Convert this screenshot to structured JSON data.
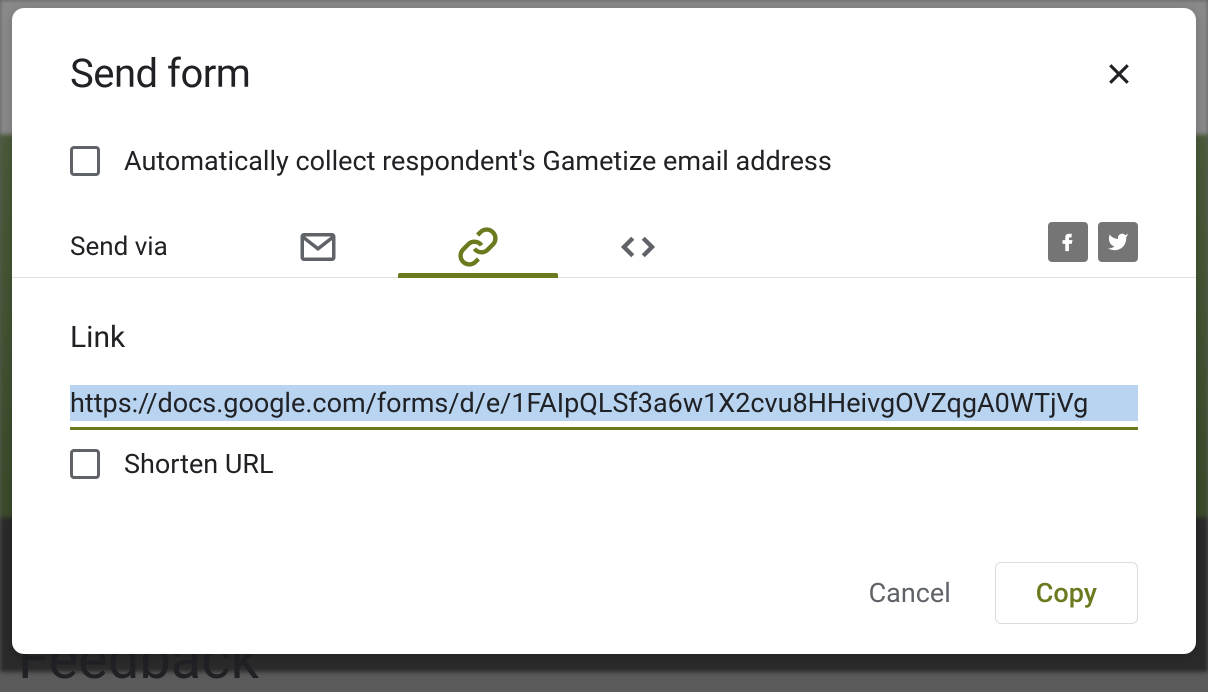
{
  "dialog": {
    "title": "Send form",
    "collect_email_label": "Automatically collect respondent's Gametize email address",
    "send_via_label": "Send via",
    "link_label": "Link",
    "link_value": "https://docs.google.com/forms/d/e/1FAIpQLSf3a6w1X2cvu8HHeivgOVZqgA0WTjVg",
    "shorten_label": "Shorten URL",
    "cancel_label": "Cancel",
    "copy_label": "Copy"
  },
  "colors": {
    "accent": "#6b7a1e"
  },
  "background_text": "Feedback"
}
